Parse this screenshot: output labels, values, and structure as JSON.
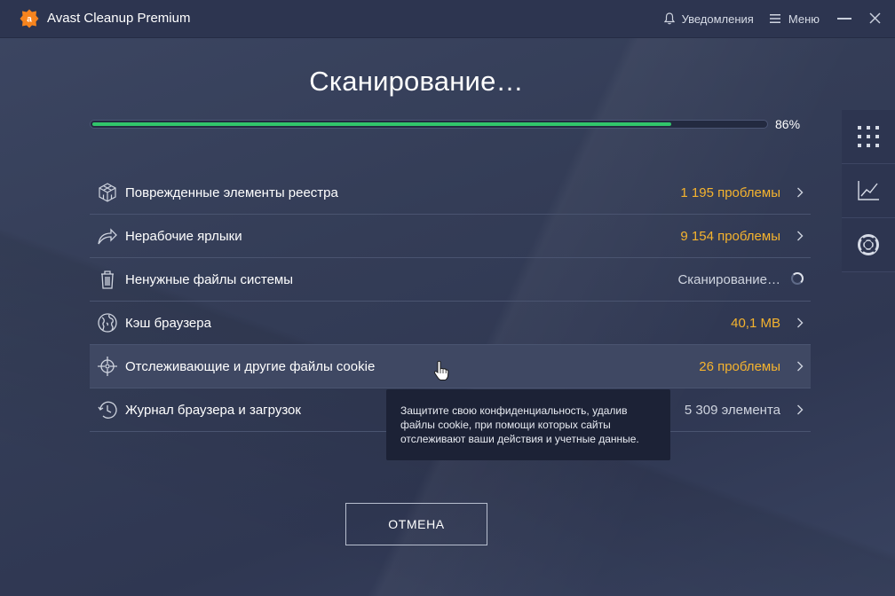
{
  "titlebar": {
    "app_title": "Avast Cleanup Premium",
    "notifications_label": "Уведомления",
    "menu_label": "Меню",
    "brand_color": "#f7841e"
  },
  "scan": {
    "heading": "Сканирование…",
    "progress_percent": 86,
    "progress_text": "86%",
    "progress_color": "#31c56b"
  },
  "results": [
    {
      "label": "Поврежденные элементы реестра",
      "value": "1 195 проблемы",
      "icon": "registry-cube-icon",
      "status": "warning"
    },
    {
      "label": "Нерабочие ярлыки",
      "value": "9 154 проблемы",
      "icon": "broken-shortcut-arrow-icon",
      "status": "warning"
    },
    {
      "label": "Ненужные файлы системы",
      "value": "Сканирование…",
      "icon": "trash-bin-icon",
      "status": "scanning"
    },
    {
      "label": "Кэш браузера",
      "value": "40,1 MB",
      "icon": "globe-icon",
      "status": "warning"
    },
    {
      "label": "Отслеживающие и другие файлы cookie",
      "value": "26 проблемы",
      "icon": "crosshair-tracking-icon",
      "status": "warning"
    },
    {
      "label": "Журнал браузера и загрузок",
      "value": "5 309 элемента",
      "icon": "history-clock-icon",
      "status": "info"
    }
  ],
  "tooltip": {
    "text": "Защитите свою конфиденциальность, удалив файлы cookie, при помощи которых сайты отслеживают ваши действия и учетные данные."
  },
  "cancel_label": "ОТМЕНА",
  "side_panel": [
    {
      "icon": "grid-apps-icon"
    },
    {
      "icon": "performance-chart-icon"
    },
    {
      "icon": "help-lifebuoy-icon"
    }
  ],
  "colors": {
    "warning": "#f5b32e",
    "background": "#343d57"
  }
}
